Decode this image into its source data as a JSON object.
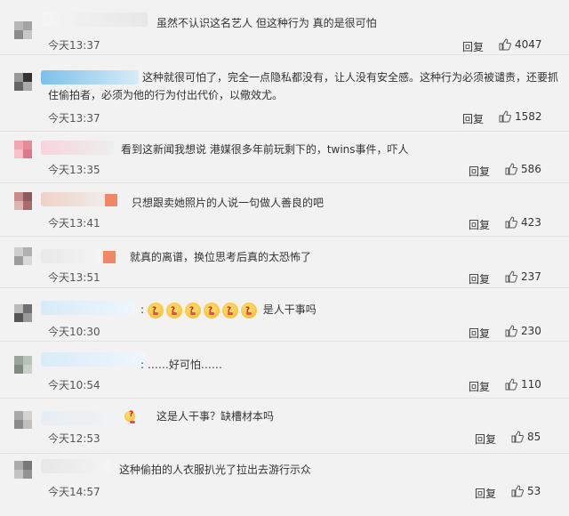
{
  "comments": [
    {
      "text": "虽然不认识这名艺人 但这种行为 真的是很可怕",
      "time": "今天13:37",
      "reply": "回复",
      "likes": "4047"
    },
    {
      "text_line1": "这种就很可怕了，完全一点隐私都没有，让人没有安全感。这种行为必须被谴责，还要抓",
      "text_line2": "住偷拍者，必须为他的行为付出代价，以儆效尤。",
      "time": "今天13:37",
      "reply": "回复",
      "likes": "1582"
    },
    {
      "text": "看到这新闻我想说 港媒很多年前玩剩下的，twins事件，吓人",
      "time": "今天13:35",
      "reply": "回复",
      "likes": "586"
    },
    {
      "text": "只想跟卖她照片的人说一句做人善良的吧",
      "time": "今天13:41",
      "reply": "回复",
      "likes": "423"
    },
    {
      "text": "就真的离谱，换位思考后真的太恐怖了",
      "time": "今天13:51",
      "reply": "回复",
      "likes": "237"
    },
    {
      "prefix": ":",
      "text": "是人干事吗",
      "time": "今天10:30",
      "reply": "回复",
      "likes": "230"
    },
    {
      "text": ": ……好可怕……",
      "time": "今天10:54",
      "reply": "回复",
      "likes": "110"
    },
    {
      "text": "这是人干事？缺槽材本吗",
      "time": "今天12:53",
      "reply": "回复",
      "likes": "85"
    },
    {
      "text": "这种偷拍的人衣服扒光了拉出去游行示众",
      "time": "今天14:57",
      "reply": "回复",
      "likes": "53"
    }
  ],
  "icons": {
    "like": "thumbs-up-icon"
  },
  "colors": {
    "background": "#f2f2f2",
    "text": "#333333"
  }
}
